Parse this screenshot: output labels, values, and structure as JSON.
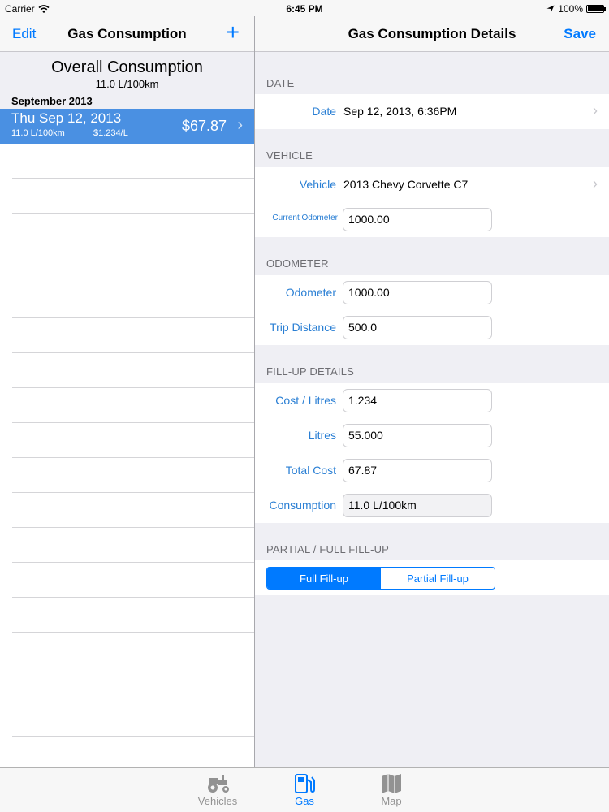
{
  "status_bar": {
    "carrier": "Carrier",
    "time": "6:45 PM",
    "battery": "100%",
    "battery_level": 1.0
  },
  "master": {
    "edit_label": "Edit",
    "title": "Gas Consumption",
    "add_label": "+",
    "overall_title": "Overall Consumption",
    "overall_value": "11.0 L/100km",
    "section_header": "September 2013",
    "entry": {
      "date": "Thu Sep 12, 2013",
      "consumption": "11.0 L/100km",
      "price_per_litre": "$1.234/L",
      "amount": "$67.87"
    }
  },
  "detail": {
    "title": "Gas Consumption Details",
    "save_label": "Save",
    "date_section": "DATE",
    "date_label": "Date",
    "date_value": "Sep 12, 2013, 6:36PM",
    "vehicle_section": "VEHICLE",
    "vehicle_label": "Vehicle",
    "vehicle_value": "2013 Chevy Corvette C7",
    "current_odometer_label": "Current Odometer",
    "current_odometer_value": "1000.00",
    "odometer_section": "ODOMETER",
    "odometer_label": "Odometer",
    "odometer_value": "1000.00",
    "trip_label": "Trip Distance",
    "trip_value": "500.0",
    "fillup_section": "FILL-UP DETAILS",
    "cost_label": "Cost / Litres",
    "cost_value": "1.234",
    "litres_label": "Litres",
    "litres_value": "55.000",
    "total_label": "Total Cost",
    "total_value": "67.87",
    "consumption_label": "Consumption",
    "consumption_value": "11.0 L/100km",
    "partial_section": "PARTIAL / FULL FILL-UP",
    "segment_full": "Full Fill-up",
    "segment_partial": "Partial Fill-up"
  },
  "tabs": [
    {
      "label": "Vehicles",
      "icon": "tractor-icon"
    },
    {
      "label": "Gas",
      "icon": "gas-pump-icon"
    },
    {
      "label": "Map",
      "icon": "map-icon"
    }
  ],
  "colors": {
    "accent": "#007aff",
    "selection": "#4a90e2",
    "label_blue": "#2a7fd4"
  }
}
